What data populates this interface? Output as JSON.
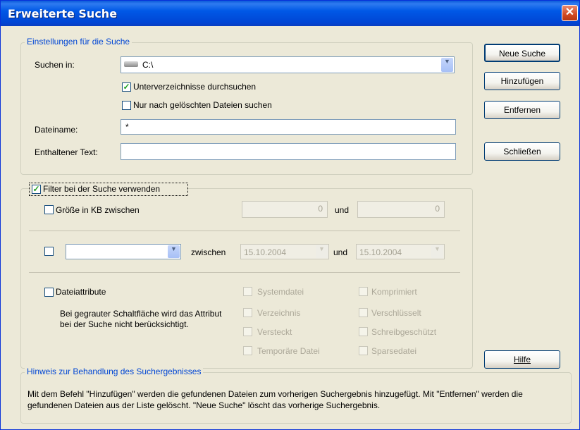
{
  "window": {
    "title": "Erweiterte Suche"
  },
  "buttons": {
    "new_search": "Neue Suche",
    "add": "Hinzufügen",
    "remove": "Entfernen",
    "close": "Schließen",
    "help": "Hilfe"
  },
  "settings": {
    "legend": "Einstellungen für die Suche",
    "search_in_label": "Suchen in:",
    "search_in_value": "C:\\",
    "subdirs_label": "Unterverzeichnisse durchsuchen",
    "subdirs_checked": true,
    "deleted_only_label": "Nur nach gelöschten Dateien suchen",
    "deleted_only_checked": false,
    "filename_label": "Dateiname:",
    "filename_value": "*",
    "contains_label": "Enthaltener Text:",
    "contains_value": ""
  },
  "filter": {
    "use_label": "Filter bei der Suche verwenden",
    "use_checked": true,
    "size_label": "Größe in KB zwischen",
    "size_from": "0",
    "and1": "und",
    "size_to": "0",
    "date_type_value": "",
    "between_label": "zwischen",
    "date_from": "15.10.2004",
    "and2": "und",
    "date_to": "15.10.2004",
    "attrs_label": "Dateiattribute",
    "attrs_note": "Bei gegrauter Schaltfläche wird das Attribut bei der Suche nicht berücksichtigt.",
    "attributes_left": [
      "Systemdatei",
      "Verzeichnis",
      "Versteckt",
      "Temporäre Datei"
    ],
    "attributes_right": [
      "Komprimiert",
      "Verschlüsselt",
      "Schreibgeschützt",
      "Sparsedatei"
    ]
  },
  "hint": {
    "legend": "Hinweis zur Behandlung des Suchergebnisses",
    "text": "Mit dem Befehl \"Hinzufügen\" werden die gefundenen Dateien zum vorherigen Suchergebnis hinzugefügt. Mit \"Entfernen\" werden die gefundenen Dateien aus der Liste gelöscht. \"Neue Suche\" löscht das vorherige Suchergebnis."
  },
  "icons": {
    "drive": "hard-drive-icon",
    "check": "checkmark-icon",
    "dropdown": "chevron-down-icon",
    "close": "close-icon"
  },
  "colors": {
    "title_bar": "#0058e6",
    "legend_text": "#0046d5",
    "close_button": "#d24a22",
    "dialog_bg": "#ece9d8"
  }
}
